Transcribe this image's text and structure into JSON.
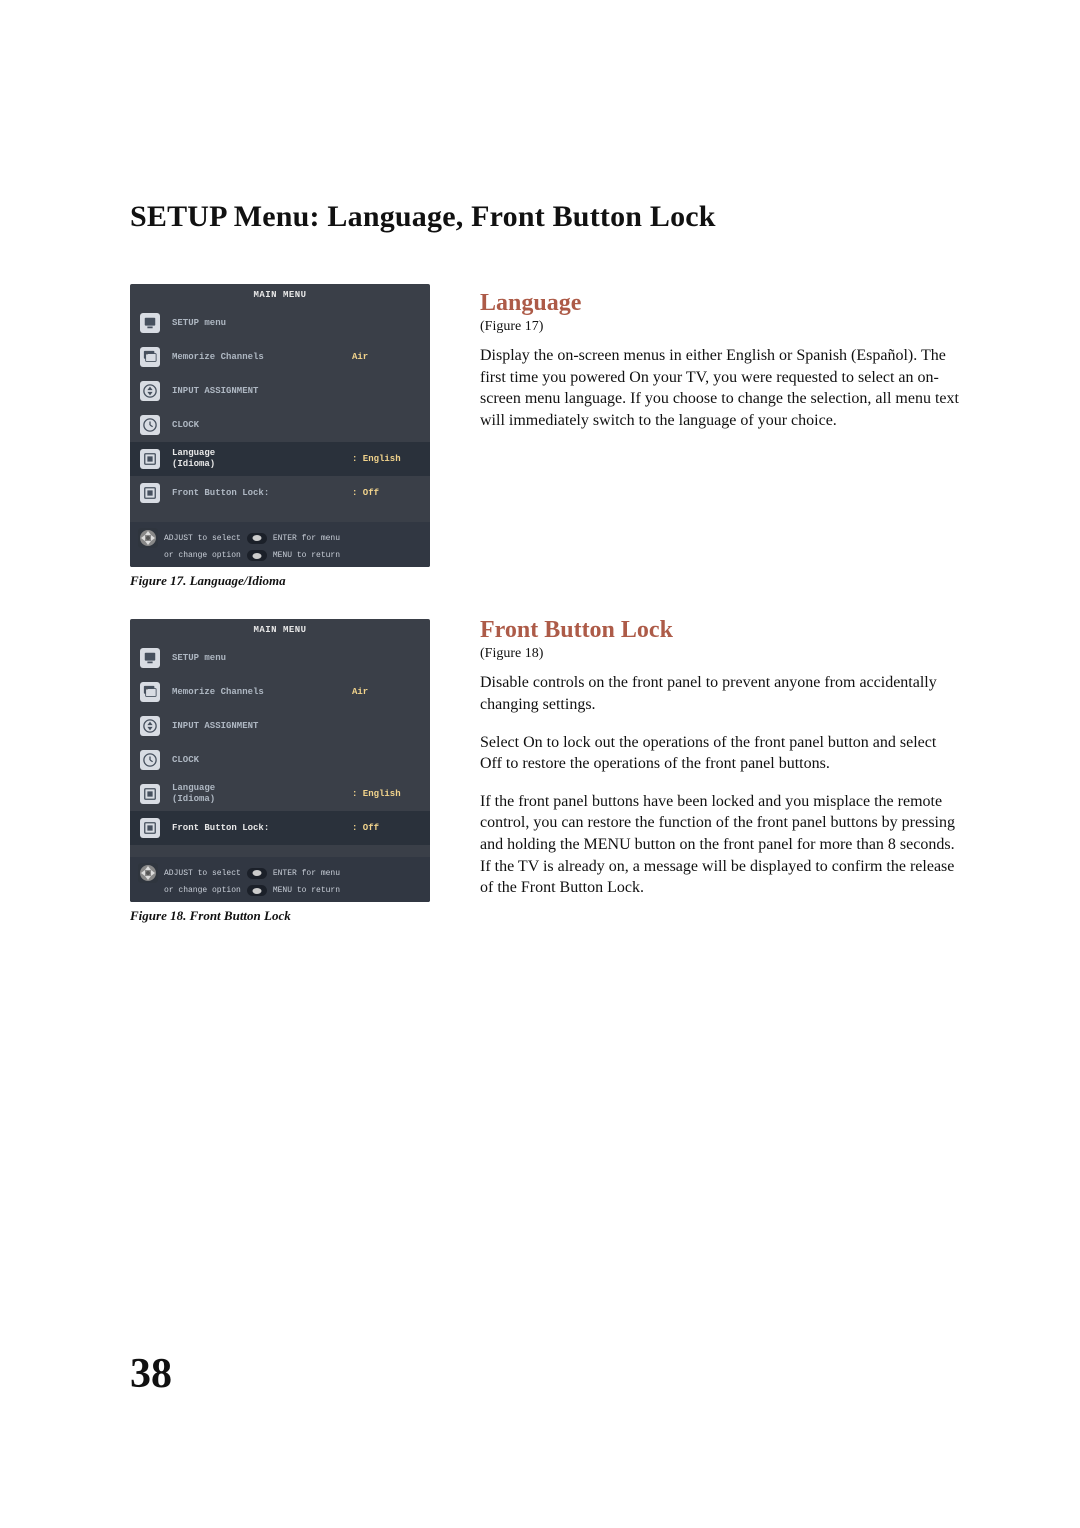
{
  "page": {
    "title": "SETUP Menu: Language, Front Button Lock",
    "number": "38"
  },
  "colors": {
    "heading": "#ad5b48",
    "osd_bg": "#3a3f48",
    "osd_highlight": "#2a313b",
    "osd_value": "#f2d48c"
  },
  "figure17": {
    "caption": "Figure 17. Language/Idioma",
    "osd_title": "MAIN MENU",
    "rows": [
      {
        "icon": "monitor",
        "label": "SETUP menu",
        "value": ""
      },
      {
        "icon": "monitor-2",
        "label": "Memorize Channels",
        "value": "Air"
      },
      {
        "icon": "updown",
        "label": "INPUT ASSIGNMENT",
        "value": ""
      },
      {
        "icon": "clock",
        "label": "CLOCK",
        "value": ""
      },
      {
        "icon": "square",
        "label": "Language\n(Idioma)",
        "value": ": English",
        "highlight": true
      },
      {
        "icon": "square",
        "label": "Front Button Lock:",
        "value": ": Off"
      }
    ],
    "hints": {
      "line1_a": "ADJUST to select",
      "line1_b": "ENTER for menu",
      "line2_a": "or change option",
      "line2_b": "MENU to return"
    }
  },
  "figure18": {
    "caption": "Figure 18. Front Button Lock",
    "osd_title": "MAIN MENU",
    "rows": [
      {
        "icon": "monitor",
        "label": "SETUP menu",
        "value": ""
      },
      {
        "icon": "monitor-2",
        "label": "Memorize Channels",
        "value": "Air"
      },
      {
        "icon": "updown",
        "label": "INPUT ASSIGNMENT",
        "value": ""
      },
      {
        "icon": "clock",
        "label": "CLOCK",
        "value": ""
      },
      {
        "icon": "square",
        "label": "Language\n(Idioma)",
        "value": ": English"
      },
      {
        "icon": "square",
        "label": "Front Button Lock:",
        "value": ": Off",
        "highlight": true
      }
    ],
    "hints": {
      "line1_a": "ADJUST to select",
      "line1_b": "ENTER for menu",
      "line2_a": "or change option",
      "line2_b": "MENU to return"
    }
  },
  "sections": {
    "language": {
      "heading": "Language",
      "fig_ref": "(Figure 17)",
      "p1": "Display the on-screen menus in either English or Spanish (Español).  The first time you powered On your TV, you were requested to select an on-screen menu language.  If you choose to change the selection, all menu text will immediately switch to the language of your choice."
    },
    "front_button_lock": {
      "heading": "Front Button Lock",
      "fig_ref": "(Figure 18)",
      "p1": "Disable controls on the front panel to prevent anyone from accidentally changing settings.",
      "p2": "Select On to lock out the operations of the front panel button and select Off to restore the operations of the front panel buttons.",
      "p3": "If the front panel buttons have been locked and you misplace the remote control, you can restore the function of the front panel buttons by pressing and holding the MENU button on the front panel  for more than 8 seconds.  If the TV is already on, a message will be displayed to confirm the release of the Front Button Lock."
    }
  }
}
